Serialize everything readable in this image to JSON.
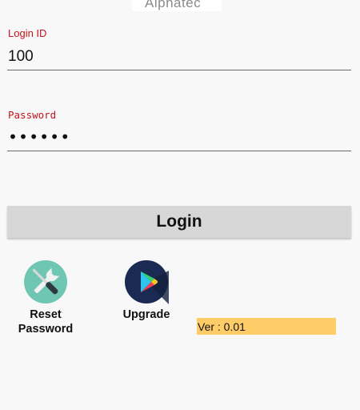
{
  "header": {
    "logo_text": "Alphatec"
  },
  "login_form": {
    "login_id_label": "Login ID",
    "login_id_value": "100",
    "password_label": "Password",
    "password_value": "123456",
    "login_button_label": "Login"
  },
  "actions": {
    "reset_password_label": "Reset\nPassword",
    "reset_icon": "tools-icon",
    "upgrade_label": "Upgrade",
    "upgrade_icon": "play-store-icon"
  },
  "footer": {
    "version_text": "Ver : 0.01"
  },
  "colors": {
    "label_red": "#c4141b",
    "button_gray": "#d6d7d6",
    "reset_icon_bg": "#6fc7b3",
    "upgrade_icon_bg": "#1a2a52",
    "version_bg": "#ffcd67"
  }
}
